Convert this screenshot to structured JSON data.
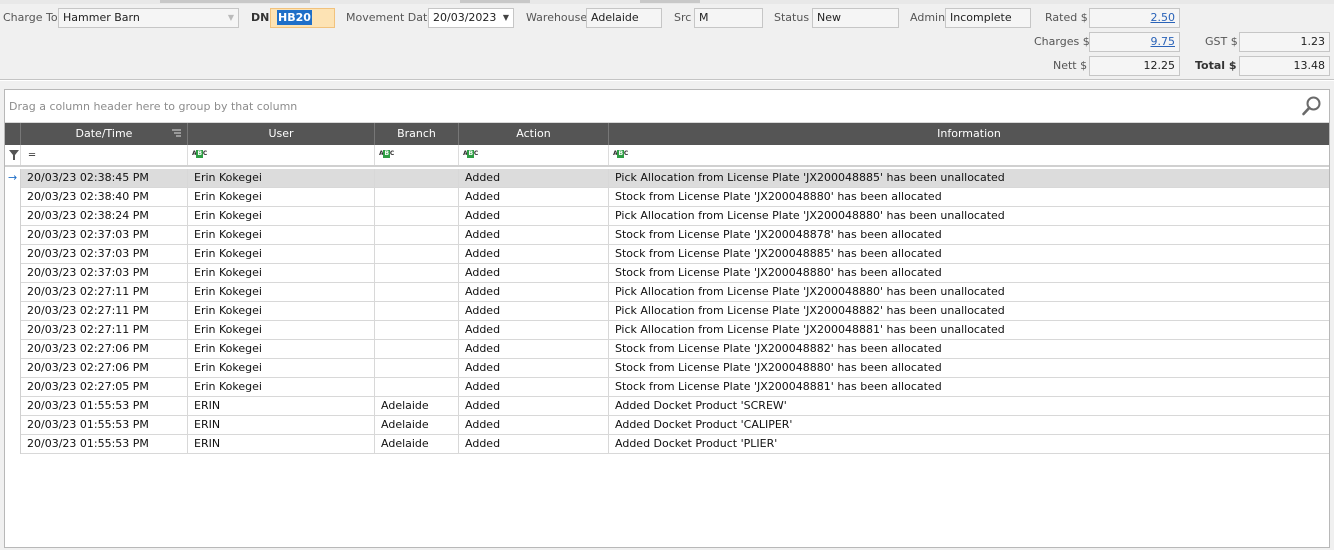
{
  "header": {
    "charge_to_label": "Charge To",
    "charge_to_value": "Hammer Barn",
    "dn_label": "DN",
    "dn_value": "HB20",
    "movement_date_label": "Movement Date",
    "movement_date_value": "20/03/2023",
    "warehouse_label": "Warehouse",
    "warehouse_value": "Adelaide",
    "src_label": "Src",
    "src_value": "M",
    "status_label": "Status",
    "status_value": "New",
    "admin_label": "Admin",
    "admin_value": "Incomplete",
    "rated_label": "Rated $",
    "rated_value": "2.50",
    "charges_label": "Charges $",
    "charges_value": "9.75",
    "gst_label": "GST $",
    "gst_value": "1.23",
    "nett_label": "Nett $",
    "nett_value": "12.25",
    "total_label": "Total $",
    "total_value": "13.48"
  },
  "grid": {
    "group_hint": "Drag a column header here to group by that column",
    "columns": [
      "Date/Time",
      "User",
      "Branch",
      "Action",
      "Information"
    ],
    "rows": [
      [
        "20/03/23 02:38:45 PM",
        "Erin Kokegei",
        "",
        "Added",
        "Pick Allocation from License Plate 'JX200048885' has been unallocated"
      ],
      [
        "20/03/23 02:38:40 PM",
        "Erin Kokegei",
        "",
        "Added",
        "Stock from License Plate 'JX200048880' has been allocated"
      ],
      [
        "20/03/23 02:38:24 PM",
        "Erin Kokegei",
        "",
        "Added",
        "Pick Allocation from License Plate 'JX200048880' has been unallocated"
      ],
      [
        "20/03/23 02:37:03 PM",
        "Erin Kokegei",
        "",
        "Added",
        "Stock from License Plate 'JX200048878' has been allocated"
      ],
      [
        "20/03/23 02:37:03 PM",
        "Erin Kokegei",
        "",
        "Added",
        "Stock from License Plate 'JX200048885' has been allocated"
      ],
      [
        "20/03/23 02:37:03 PM",
        "Erin Kokegei",
        "",
        "Added",
        "Stock from License Plate 'JX200048880' has been allocated"
      ],
      [
        "20/03/23 02:27:11 PM",
        "Erin Kokegei",
        "",
        "Added",
        "Pick Allocation from License Plate 'JX200048880' has been unallocated"
      ],
      [
        "20/03/23 02:27:11 PM",
        "Erin Kokegei",
        "",
        "Added",
        "Pick Allocation from License Plate 'JX200048882' has been unallocated"
      ],
      [
        "20/03/23 02:27:11 PM",
        "Erin Kokegei",
        "",
        "Added",
        "Pick Allocation from License Plate 'JX200048881' has been unallocated"
      ],
      [
        "20/03/23 02:27:06 PM",
        "Erin Kokegei",
        "",
        "Added",
        "Stock from License Plate 'JX200048882' has been allocated"
      ],
      [
        "20/03/23 02:27:06 PM",
        "Erin Kokegei",
        "",
        "Added",
        "Stock from License Plate 'JX200048880' has been allocated"
      ],
      [
        "20/03/23 02:27:05 PM",
        "Erin Kokegei",
        "",
        "Added",
        "Stock from License Plate 'JX200048881' has been allocated"
      ],
      [
        "20/03/23 01:55:53 PM",
        "ERIN",
        "Adelaide",
        "Added",
        "Added Docket Product 'SCREW'"
      ],
      [
        "20/03/23 01:55:53 PM",
        "ERIN",
        "Adelaide",
        "Added",
        "Added Docket Product 'CALIPER'"
      ],
      [
        "20/03/23 01:55:53 PM",
        "ERIN",
        "Adelaide",
        "Added",
        "Added Docket Product 'PLIER'"
      ]
    ]
  },
  "icons": {
    "search": "search-icon",
    "filter": "filter-icon",
    "sort": "sort-icon",
    "row_indicator": "row-arrow-icon"
  },
  "colors": {
    "header_bg": "#555555",
    "dn_bg": "#fde3b4",
    "link": "#2a63b8",
    "selected_row": "#dcdcdc"
  }
}
